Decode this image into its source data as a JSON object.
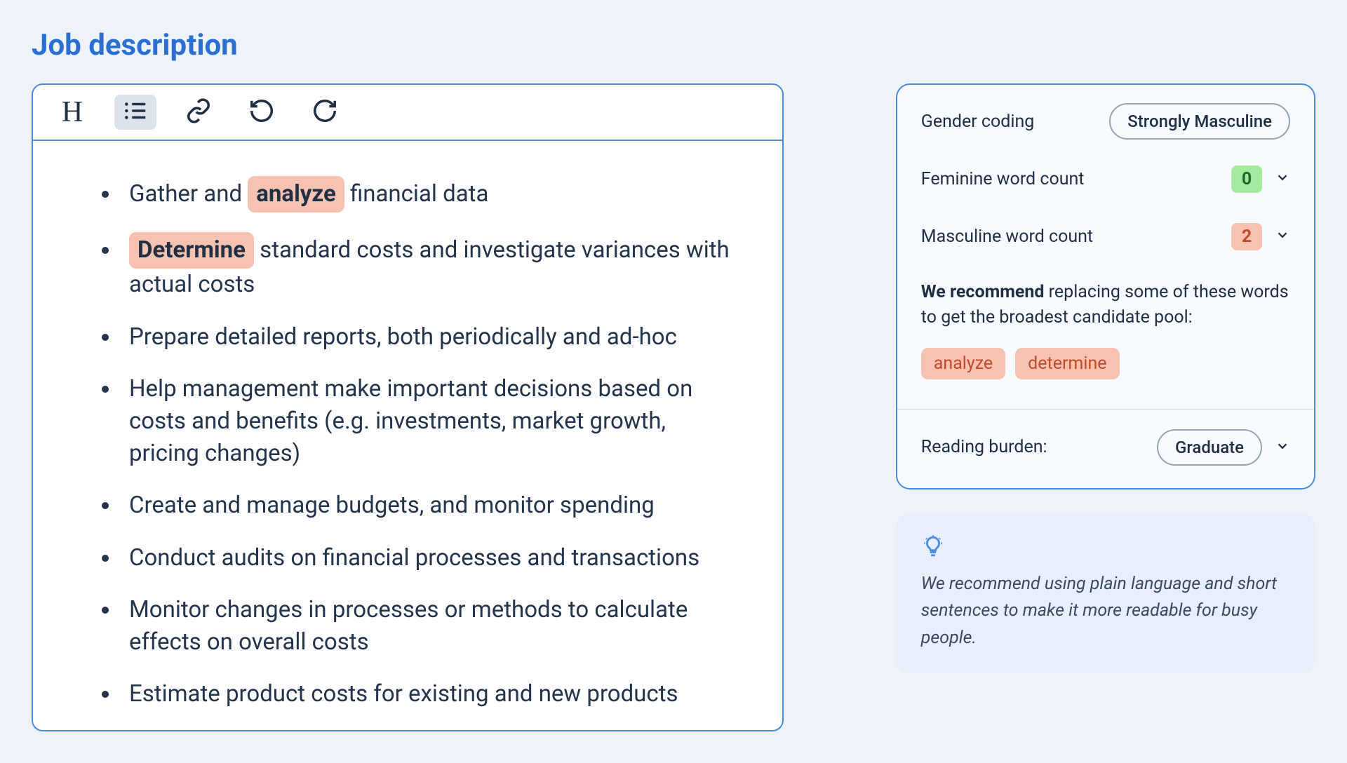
{
  "title": "Job description",
  "bullets": [
    {
      "pre": "Gather and ",
      "hl": "analyze",
      "post": " financial data"
    },
    {
      "pre": "",
      "hl": "Determine",
      "post": " standard costs and investigate variances with actual costs"
    },
    {
      "text": "Prepare detailed reports, both periodically and ad-hoc"
    },
    {
      "text": "Help management make important decisions based on costs and benefits (e.g. investments, market growth, pricing changes)"
    },
    {
      "text": "Create and manage budgets, and monitor spending"
    },
    {
      "text": "Conduct audits on financial processes and transactions"
    },
    {
      "text": "Monitor changes in processes or methods to calculate effects on overall costs"
    },
    {
      "text": "Estimate product costs for existing and new products"
    }
  ],
  "analysis": {
    "gender_label": "Gender coding",
    "gender_value": "Strongly Masculine",
    "fem_label": "Feminine word count",
    "fem_count": "0",
    "masc_label": "Masculine word count",
    "masc_count": "2",
    "recommend_bold": "We recommend",
    "recommend_rest": " replacing some of these words to get the broadest candidate pool:",
    "words": [
      "analyze",
      "determine"
    ],
    "reading_label": "Reading burden:",
    "reading_value": "Graduate"
  },
  "tip": "We recommend using plain language and short sentences to make it more readable for busy people."
}
